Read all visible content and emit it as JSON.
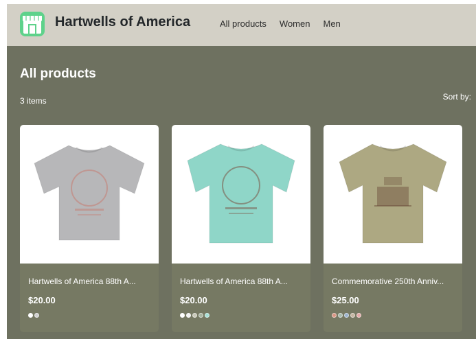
{
  "header": {
    "brand": "Hartwells of America",
    "nav": [
      "All products",
      "Women",
      "Men"
    ]
  },
  "main": {
    "title": "All products",
    "count": "3 items",
    "sort_label": "Sort by:"
  },
  "products": [
    {
      "name": "Hartwells of America 88th A...",
      "price": "$20.00",
      "shirt_color": "#b7b7b9",
      "swatches": [
        "#ffffff",
        "#cfcfcf"
      ]
    },
    {
      "name": "Hartwells of America 88th A...",
      "price": "$20.00",
      "shirt_color": "#8fd6c8",
      "swatches": [
        "#ffffff",
        "#f2f2f2",
        "#c8c8b8",
        "#a8b4a0",
        "#a6dfd6"
      ]
    },
    {
      "name": "Commemorative 250th Anniv...",
      "price": "$25.00",
      "shirt_color": "#ada882",
      "swatches": [
        "#d99583",
        "#a7b9aa",
        "#9ab2cc",
        "#c4b4a0",
        "#e4a9a7"
      ]
    }
  ],
  "colors": {
    "header_bg": "#d3d0c6",
    "main_bg": "#6e7160",
    "card_bg": "#767963",
    "logo_green": "#5ed28b"
  },
  "icons": {
    "logo": "storefront-icon",
    "product_images": [
      "tshirt-icon",
      "tshirt-icon",
      "tshirt-icon"
    ]
  }
}
